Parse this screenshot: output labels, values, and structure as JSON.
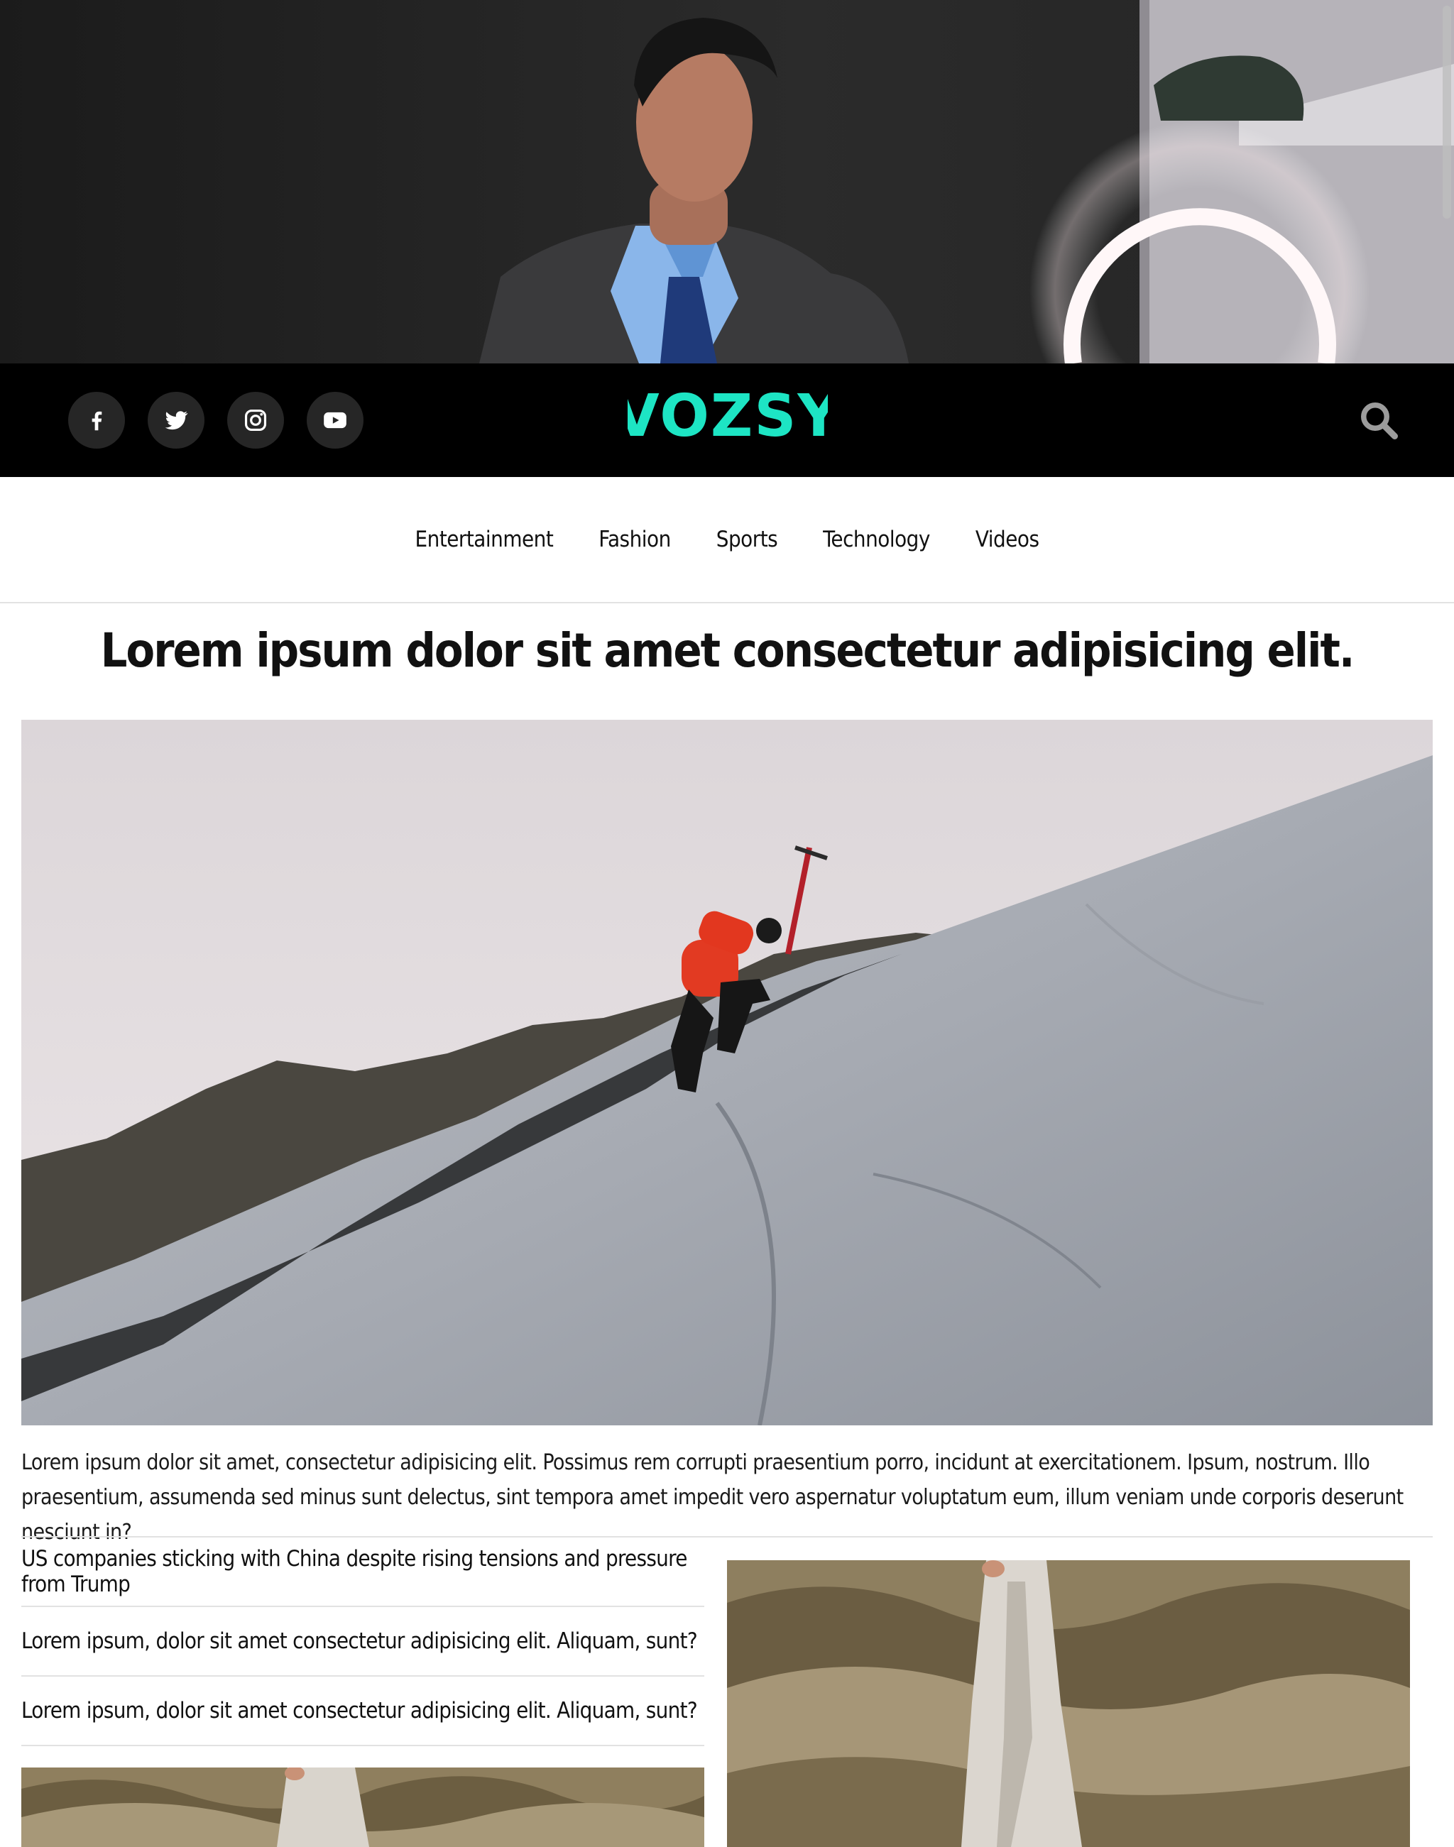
{
  "social": [
    {
      "icon": "facebook-icon"
    },
    {
      "icon": "twitter-icon"
    },
    {
      "icon": "instagram-icon"
    },
    {
      "icon": "youtube-icon"
    }
  ],
  "brand": {
    "logo": "VOZSY",
    "accent": "#1de5c4",
    "bar_bg": "#000000"
  },
  "nav": {
    "items": [
      {
        "label": "Entertainment"
      },
      {
        "label": "Fashion"
      },
      {
        "label": "Sports"
      },
      {
        "label": "Technology"
      },
      {
        "label": "Videos"
      }
    ]
  },
  "article": {
    "headline": "Lorem ipsum dolor sit amet consectetur adipisicing elit.",
    "lead": "Lorem ipsum dolor sit amet, consectetur adipisicing elit. Possimus rem corrupti praesentium porro, incidunt at exercitationem. Ipsum, nostrum. Illo praesentium, assumenda sed minus sunt delectus, sint tempora amet impedit vero aspernatur voluptatum eum, illum veniam unde corporis deserunt nesciunt in?"
  },
  "related": [
    {
      "title": "US companies sticking with China despite rising tensions and pressure from Trump"
    },
    {
      "title": "Lorem ipsum, dolor sit amet consectetur adipisicing elit. Aliquam, sunt?"
    },
    {
      "title": "Lorem ipsum, dolor sit amet consectetur adipisicing elit. Aliquam, sunt?"
    }
  ]
}
